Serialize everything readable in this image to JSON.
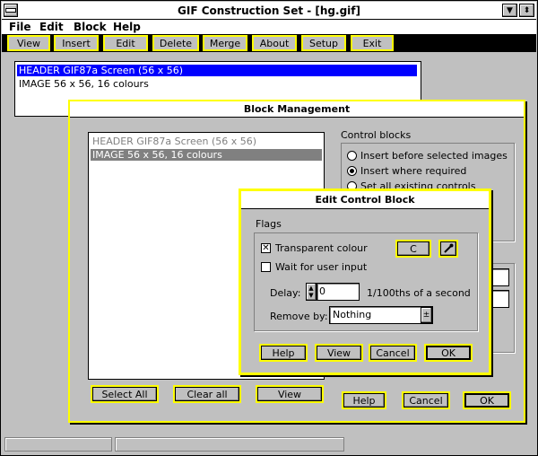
{
  "app": {
    "title": "GIF Construction Set - [hg.gif]",
    "menu": [
      "File",
      "Edit",
      "Block",
      "Help"
    ],
    "toolbar": [
      "View",
      "Insert",
      "Edit",
      "Delete",
      "Merge",
      "About",
      "Setup",
      "Exit"
    ]
  },
  "main_list": [
    "HEADER GIF87a Screen (56 x 56)",
    "IMAGE 56 x 56, 16 colours"
  ],
  "block_mgmt": {
    "title": "Block Management",
    "list": [
      "HEADER GIF87a Screen (56 x 56)",
      "IMAGE 56 x 56, 16 colours"
    ],
    "buttons": {
      "select_all": "Select All",
      "clear_all": "Clear all",
      "view": "View",
      "help": "Help",
      "cancel": "Cancel",
      "ok": "OK"
    },
    "control_blocks": {
      "label": "Control blocks",
      "options": [
        "Insert before selected images",
        "Insert where required",
        "Set all existing controls"
      ],
      "selected": 1
    }
  },
  "edit_control": {
    "title": "Edit Control Block",
    "flags_label": "Flags",
    "transparent_label": "Transparent colour",
    "transparent_checked": true,
    "colour_button": "C",
    "wait_label": "Wait for user input",
    "wait_checked": false,
    "delay_label": "Delay:",
    "delay_value": "0",
    "delay_unit": "1/100ths of a second",
    "remove_label": "Remove by:",
    "remove_value": "Nothing",
    "buttons": {
      "help": "Help",
      "view": "View",
      "cancel": "Cancel",
      "ok": "OK"
    }
  },
  "icons": {
    "system_menu": "system-menu-icon",
    "minimize": "minimize-icon",
    "restore": "restore-icon",
    "eyedropper": "eyedropper-icon",
    "spinner": "spinner-icon",
    "dropdown": "dropdown-arrow-icon"
  },
  "colors": {
    "accent_border": "#ffff00",
    "selection": "#0000ff",
    "face": "#c0c0c0"
  }
}
